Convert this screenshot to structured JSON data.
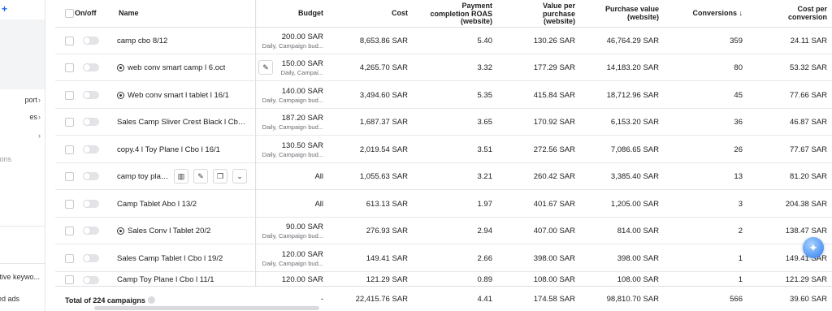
{
  "sidebar": {
    "add_icon": "+",
    "items": [
      {
        "label": "port",
        "chevron": "›",
        "muted": false
      },
      {
        "label": "es",
        "chevron": "›",
        "muted": false
      },
      {
        "label": "",
        "chevron": "›",
        "muted": false
      },
      {
        "label": "ons",
        "chevron": "",
        "muted": true
      },
      {
        "label": "tive keywo...",
        "chevron": "",
        "muted": false
      },
      {
        "label": "ed ads",
        "chevron": "",
        "muted": false
      }
    ]
  },
  "table": {
    "headers": {
      "onoff": "On/off",
      "name": "Name",
      "budget": "Budget",
      "cost": "Cost",
      "roas": [
        "Payment",
        "completion ROAS",
        "(website)"
      ],
      "vpp": [
        "Value per",
        "purchase",
        "(website)"
      ],
      "pv": [
        "Purchase value",
        "(website)"
      ],
      "conversions": "Conversions ↓",
      "cpc": [
        "Cost per",
        "conversion"
      ]
    },
    "rows": [
      {
        "name": "camp cbo 8/12",
        "icon": false,
        "budget": "200.00 SAR",
        "budget_sub": "Daily, Campaign bud...",
        "cost": "8,653.86 SAR",
        "roas": "5.40",
        "vpp": "130.26 SAR",
        "pv": "46,764.29 SAR",
        "conv": "359",
        "cpc": "24.11 SAR"
      },
      {
        "name": "web conv smart camp l 6.oct",
        "icon": true,
        "budget": "150.00 SAR",
        "budget_sub": "Daily, Campai...",
        "cost": "4,265.70 SAR",
        "roas": "3.32",
        "vpp": "177.29 SAR",
        "pv": "14,183.20 SAR",
        "conv": "80",
        "cpc": "53.32 SAR"
      },
      {
        "name": "Web conv smart l tablet l 16/1",
        "icon": true,
        "budget": "140.00 SAR",
        "budget_sub": "Daily, Campaign bud...",
        "cost": "3,494.60 SAR",
        "roas": "5.35",
        "vpp": "415.84 SAR",
        "pv": "18,712.96 SAR",
        "conv": "45",
        "cpc": "77.66 SAR"
      },
      {
        "name": "Sales Camp Sliver Crest Black l Cbo ...",
        "icon": false,
        "budget": "187.20 SAR",
        "budget_sub": "Daily, Campaign bud...",
        "cost": "1,687.37 SAR",
        "roas": "3.65",
        "vpp": "170.92 SAR",
        "pv": "6,153.20 SAR",
        "conv": "36",
        "cpc": "46.87 SAR"
      },
      {
        "name": "copy.4 l Toy Plane l Cbo l 16/1",
        "icon": false,
        "budget": "130.50 SAR",
        "budget_sub": "Daily, Campaign bud...",
        "cost": "2,019.54 SAR",
        "roas": "3.51",
        "vpp": "272.56 SAR",
        "pv": "7,086.65 SAR",
        "conv": "26",
        "cpc": "77.67 SAR"
      },
      {
        "name": "camp toy plan...",
        "icon": false,
        "budget": "All",
        "budget_sub": "",
        "cost": "1,055.63 SAR",
        "roas": "3.21",
        "vpp": "260.42 SAR",
        "pv": "3,385.40 SAR",
        "conv": "13",
        "cpc": "81.20 SAR"
      },
      {
        "name": "Camp Tablet Abo l 13/2",
        "icon": false,
        "budget": "All",
        "budget_sub": "",
        "cost": "613.13 SAR",
        "roas": "1.97",
        "vpp": "401.67 SAR",
        "pv": "1,205.00 SAR",
        "conv": "3",
        "cpc": "204.38 SAR"
      },
      {
        "name": "Sales Conv l Tablet 20/2",
        "icon": true,
        "budget": "90.00 SAR",
        "budget_sub": "Daily, Campaign bud...",
        "cost": "276.93 SAR",
        "roas": "2.94",
        "vpp": "407.00 SAR",
        "pv": "814.00 SAR",
        "conv": "2",
        "cpc": "138.47 SAR"
      },
      {
        "name": "Sales Camp Tablet l Cbo l 19/2",
        "icon": false,
        "budget": "120.00 SAR",
        "budget_sub": "Daily, Campaign bud...",
        "cost": "149.41 SAR",
        "roas": "2.66",
        "vpp": "398.00 SAR",
        "pv": "398.00 SAR",
        "conv": "1",
        "cpc": "149.41 SAR"
      },
      {
        "name": "Camp Toy Plane l Cbo l 11/1",
        "icon": false,
        "budget": "120.00 SAR",
        "budget_sub": "",
        "cost": "121.29 SAR",
        "roas": "0.89",
        "vpp": "108.00 SAR",
        "pv": "108.00 SAR",
        "conv": "1",
        "cpc": "121.29 SAR"
      }
    ],
    "footer": {
      "label": "Total of 224 campaigns",
      "budget": "-",
      "cost": "22,415.76 SAR",
      "roas": "4.41",
      "vpp": "174.58 SAR",
      "pv": "98,810.70 SAR",
      "conv": "566",
      "cpc": "39.60 SAR"
    }
  },
  "row_actions": [
    "chart-icon",
    "edit-icon",
    "duplicate-icon",
    "chevron-down-icon"
  ],
  "colors": {
    "accent": "#1e63e9",
    "border": "#e8e8ec"
  }
}
